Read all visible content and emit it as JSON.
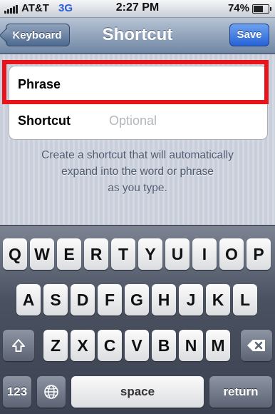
{
  "status_bar": {
    "carrier": "AT&T",
    "network": "3G",
    "time": "2:27 PM",
    "battery_percent": "74%",
    "battery_level": 0.74,
    "signal_bars": 5,
    "icons": [
      "signal-bars-icon",
      "battery-icon"
    ]
  },
  "nav": {
    "back_label": "Keyboard",
    "title": "Shortcut",
    "save_label": "Save"
  },
  "form": {
    "phrase_label": "Phrase",
    "phrase_value": "",
    "shortcut_label": "Shortcut",
    "shortcut_placeholder": "Optional",
    "shortcut_value": ""
  },
  "help": {
    "line1": "Create a shortcut that will automatically",
    "line2": "expand into the word or phrase",
    "line3": "as you type."
  },
  "keyboard": {
    "row1": [
      "Q",
      "W",
      "E",
      "R",
      "T",
      "Y",
      "U",
      "I",
      "O",
      "P"
    ],
    "row2": [
      "A",
      "S",
      "D",
      "F",
      "G",
      "H",
      "J",
      "K",
      "L"
    ],
    "row3": [
      "Z",
      "X",
      "C",
      "V",
      "B",
      "N",
      "M"
    ],
    "shift_icon": "shift-arrow-icon",
    "delete_icon": "backspace-icon",
    "numbers_label": "123",
    "globe_icon": "globe-icon",
    "space_label": "space",
    "return_label": "return"
  },
  "colors": {
    "highlight": "#e8141b",
    "save_button": "#2562d6",
    "network": "#2a5fd8"
  }
}
